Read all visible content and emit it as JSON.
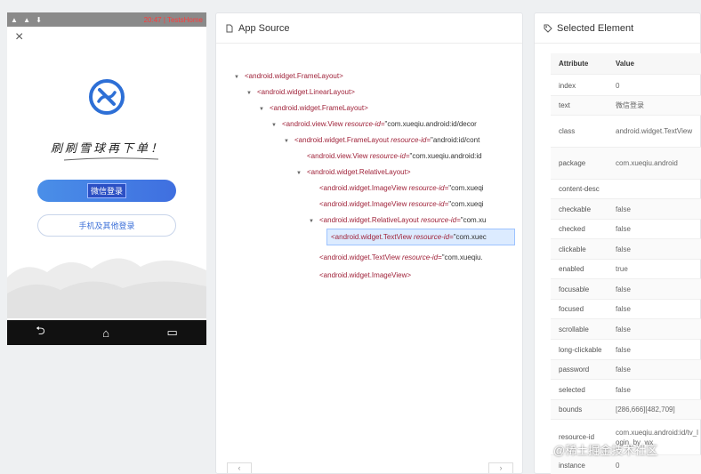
{
  "phone": {
    "status_left": "▲ ▲ ⬇",
    "status_right": "20:47 | TestsHome",
    "close_icon": "×",
    "slogan": "刷刷雪球再下单！",
    "wechat_button": "微信登录",
    "phone_button": "手机及其他登录",
    "nav_back": "⮌",
    "nav_home": "⌂",
    "nav_recent": "▭"
  },
  "source_panel": {
    "title": "App Source",
    "nodes": [
      {
        "tag": "<android.widget.FrameLayout>",
        "attr": "",
        "val": ""
      },
      {
        "tag": "<android.widget.LinearLayout>",
        "attr": "",
        "val": ""
      },
      {
        "tag": "<android.widget.FrameLayout>",
        "attr": "",
        "val": ""
      },
      {
        "tag": "<android.view.View ",
        "attr": "resource-id=",
        "val": "\"com.xueqiu.android:id/decor"
      },
      {
        "tag": "<android.widget.FrameLayout ",
        "attr": "resource-id=",
        "val": "\"android:id/cont"
      },
      {
        "tag": "<android.view.View ",
        "attr": "resource-id=",
        "val": "\"com.xueqiu.android:id"
      },
      {
        "tag": "<android.widget.RelativeLayout>",
        "attr": "",
        "val": ""
      },
      {
        "tag": "<android.widget.ImageView ",
        "attr": "resource-id=",
        "val": "\"com.xueqi"
      },
      {
        "tag": "<android.widget.ImageView ",
        "attr": "resource-id=",
        "val": "\"com.xueqi"
      },
      {
        "tag": "<android.widget.RelativeLayout ",
        "attr": "resource-id=",
        "val": "\"com.xu"
      },
      {
        "tag": "<android.widget.TextView ",
        "attr": "resource-id=",
        "val": "\"com.xuec"
      },
      {
        "tag": "<android.widget.TextView ",
        "attr": "resource-id=",
        "val": "\"com.xueqiu."
      },
      {
        "tag": "<android.widget.ImageView>",
        "attr": "",
        "val": ""
      }
    ],
    "scroll_left": "‹",
    "scroll_right": "›"
  },
  "attr_panel": {
    "title": "Selected Element",
    "col_attribute": "Attribute",
    "col_value": "Value",
    "rows": [
      {
        "k": "index",
        "v": "0"
      },
      {
        "k": "text",
        "v": "微信登录"
      },
      {
        "k": "class",
        "v": "android.widget.TextView"
      },
      {
        "k": "package",
        "v": "com.xueqiu.android"
      },
      {
        "k": "content-desc",
        "v": ""
      },
      {
        "k": "checkable",
        "v": "false"
      },
      {
        "k": "checked",
        "v": "false"
      },
      {
        "k": "clickable",
        "v": "false"
      },
      {
        "k": "enabled",
        "v": "true"
      },
      {
        "k": "focusable",
        "v": "false"
      },
      {
        "k": "focused",
        "v": "false"
      },
      {
        "k": "scrollable",
        "v": "false"
      },
      {
        "k": "long-clickable",
        "v": "false"
      },
      {
        "k": "password",
        "v": "false"
      },
      {
        "k": "selected",
        "v": "false"
      },
      {
        "k": "bounds",
        "v": "[286,666][482,709]"
      },
      {
        "k": "resource-id",
        "v": "com.xueqiu.android:id/tv_login_by_wx"
      },
      {
        "k": "instance",
        "v": "0"
      }
    ]
  },
  "watermark": "@稀土掘金技术社区"
}
